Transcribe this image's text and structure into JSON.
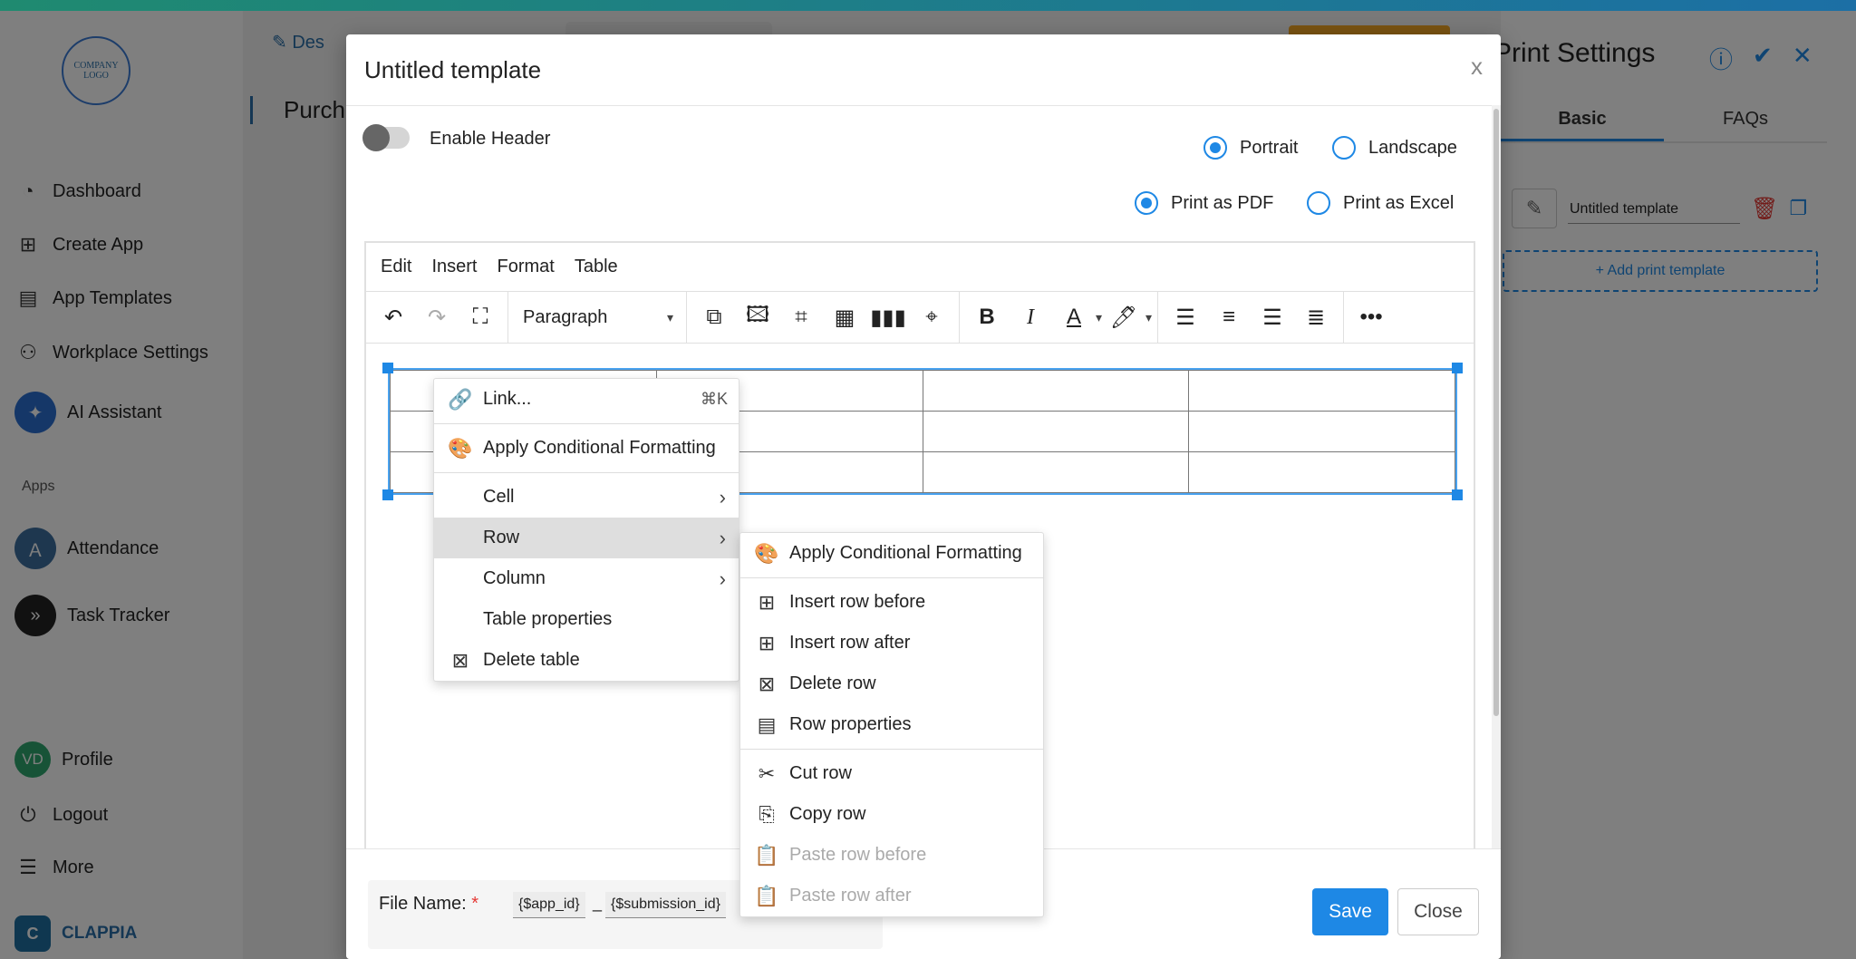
{
  "sidebar": {
    "logo_text": "COMPANY LOGO",
    "items": [
      {
        "label": "Dashboard",
        "icon": "dashboard-icon"
      },
      {
        "label": "Create App",
        "icon": "create-app-icon"
      },
      {
        "label": "App Templates",
        "icon": "app-templates-icon"
      },
      {
        "label": "Workplace Settings",
        "icon": "workplace-settings-icon"
      },
      {
        "label": "AI Assistant",
        "icon": "ai-assistant-icon"
      }
    ],
    "apps_label": "Apps",
    "apps": [
      {
        "label": "Attendance",
        "icon": "attendance-icon"
      },
      {
        "label": "Task Tracker",
        "icon": "task-tracker-icon"
      }
    ],
    "bottom": [
      {
        "label": "Profile",
        "avatar": "VD"
      },
      {
        "label": "Logout",
        "icon": "power-icon"
      },
      {
        "label": "More",
        "icon": "menu-icon"
      }
    ],
    "brand": "CLAPPIA"
  },
  "background": {
    "breadcrumb": "Des",
    "page_title": "Purch"
  },
  "print_settings": {
    "title": "Print Settings",
    "tabs": [
      "Basic",
      "FAQs"
    ],
    "active_tab": "Basic",
    "template_name": "Untitled template",
    "add_template": "+ Add print template"
  },
  "modal": {
    "title": "Untitled template",
    "close": "x",
    "enable_header": "Enable Header",
    "orientation": {
      "portrait": "Portrait",
      "landscape": "Landscape",
      "selected": "Portrait"
    },
    "print_as": {
      "pdf": "Print as PDF",
      "excel": "Print as Excel",
      "selected": "Print as PDF"
    },
    "menubar": [
      "Edit",
      "Insert",
      "Format",
      "Table"
    ],
    "block_format": "Paragraph",
    "file_name_label": "File Name:",
    "file_name_required": "*",
    "file_name_chips": [
      "{$app_id}",
      "{$submission_id}"
    ],
    "file_name_separator": "_",
    "save": "Save",
    "close_btn": "Close"
  },
  "context_menu": {
    "items": [
      {
        "label": "Link...",
        "icon": "link-icon",
        "shortcut": "⌘K"
      },
      {
        "label": "Apply Conditional Formatting",
        "icon": "palette-icon"
      },
      {
        "label": "Cell",
        "submenu": true
      },
      {
        "label": "Row",
        "submenu": true,
        "highlighted": true
      },
      {
        "label": "Column",
        "submenu": true
      },
      {
        "label": "Table properties"
      },
      {
        "label": "Delete table",
        "icon": "delete-table-icon"
      }
    ]
  },
  "row_submenu": {
    "items": [
      {
        "label": "Apply Conditional Formatting",
        "icon": "palette-icon"
      },
      {
        "label": "Insert row before",
        "icon": "insert-row-before-icon"
      },
      {
        "label": "Insert row after",
        "icon": "insert-row-after-icon"
      },
      {
        "label": "Delete row",
        "icon": "delete-row-icon"
      },
      {
        "label": "Row properties",
        "icon": "row-properties-icon"
      },
      {
        "label": "Cut row",
        "icon": "cut-row-icon"
      },
      {
        "label": "Copy row",
        "icon": "copy-row-icon"
      },
      {
        "label": "Paste row before",
        "icon": "paste-row-before-icon",
        "disabled": true
      },
      {
        "label": "Paste row after",
        "icon": "paste-row-after-icon",
        "disabled": true
      }
    ]
  },
  "colors": {
    "accent": "#1e88e5",
    "danger": "#e53935",
    "brand": "#1f8a70"
  }
}
